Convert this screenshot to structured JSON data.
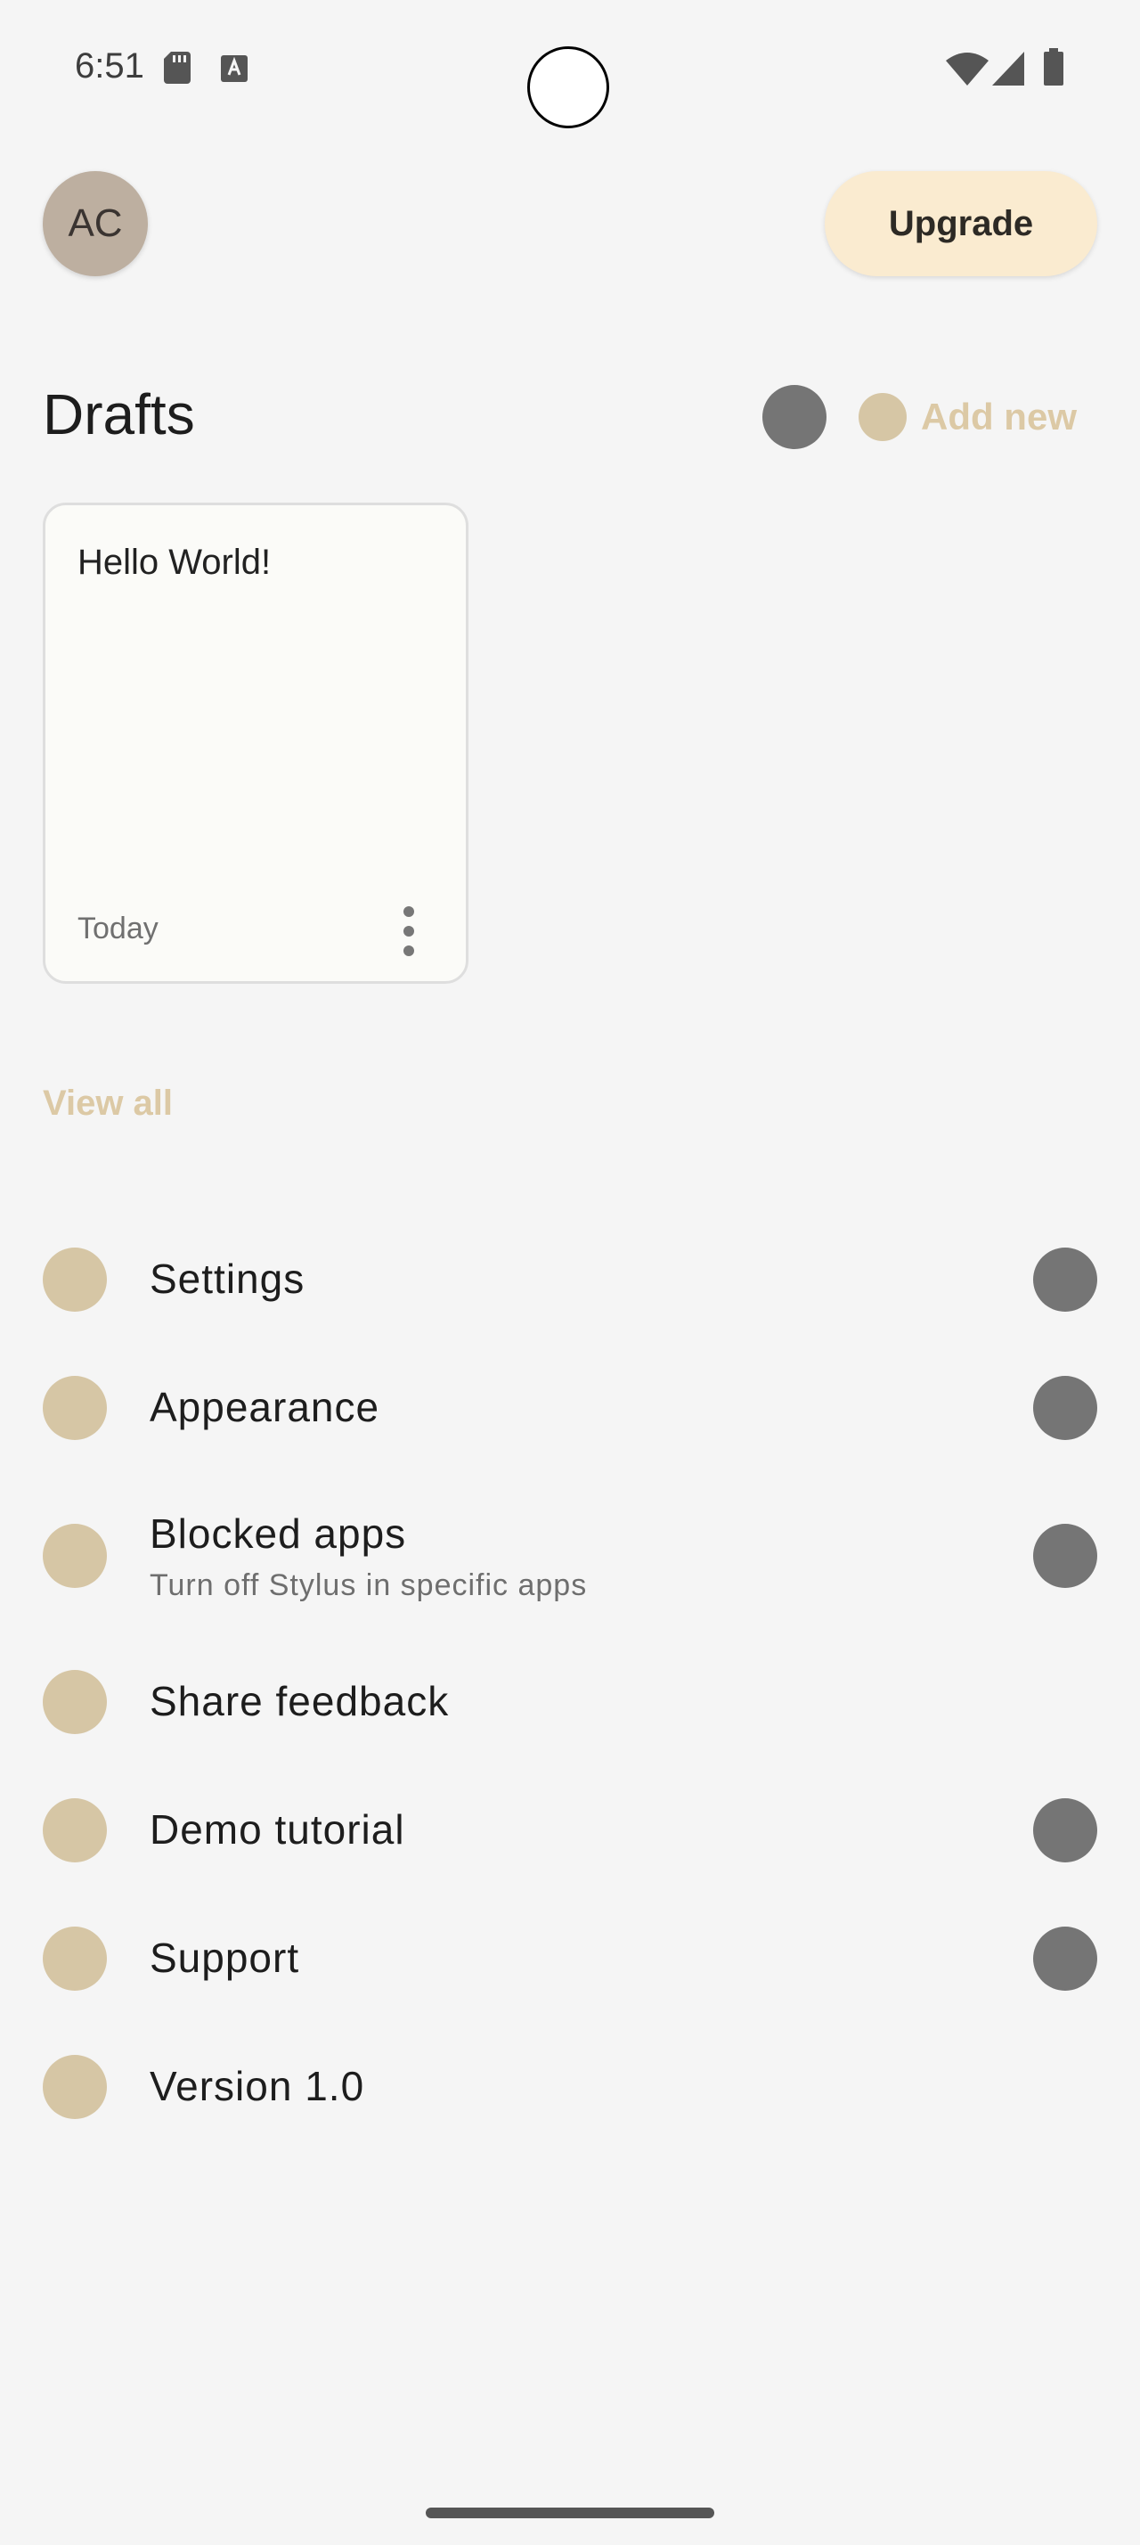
{
  "status_bar": {
    "time": "6:51",
    "icons": [
      "sd-card-icon",
      "a-notification-icon",
      "wifi-icon",
      "signal-icon",
      "battery-icon"
    ]
  },
  "header": {
    "avatar_initials": "AC",
    "upgrade_label": "Upgrade"
  },
  "drafts": {
    "title": "Drafts",
    "add_new_label": "Add new",
    "cards": [
      {
        "title": "Hello World!",
        "date": "Today"
      }
    ],
    "view_all_label": "View all"
  },
  "menu": {
    "items": [
      {
        "label": "Settings"
      },
      {
        "label": "Appearance"
      },
      {
        "label": "Blocked apps",
        "subtitle": "Turn off Stylus in specific apps"
      },
      {
        "label": "Share feedback"
      },
      {
        "label": "Demo tutorial"
      },
      {
        "label": "Support"
      },
      {
        "label": "Version 1.0"
      }
    ]
  },
  "colors": {
    "background": "#f5f5f5",
    "accent_beige": "#d6c6a5",
    "accent_text": "#dcc9a5",
    "upgrade_bg": "#faebd0",
    "icon_gray": "#757575"
  }
}
